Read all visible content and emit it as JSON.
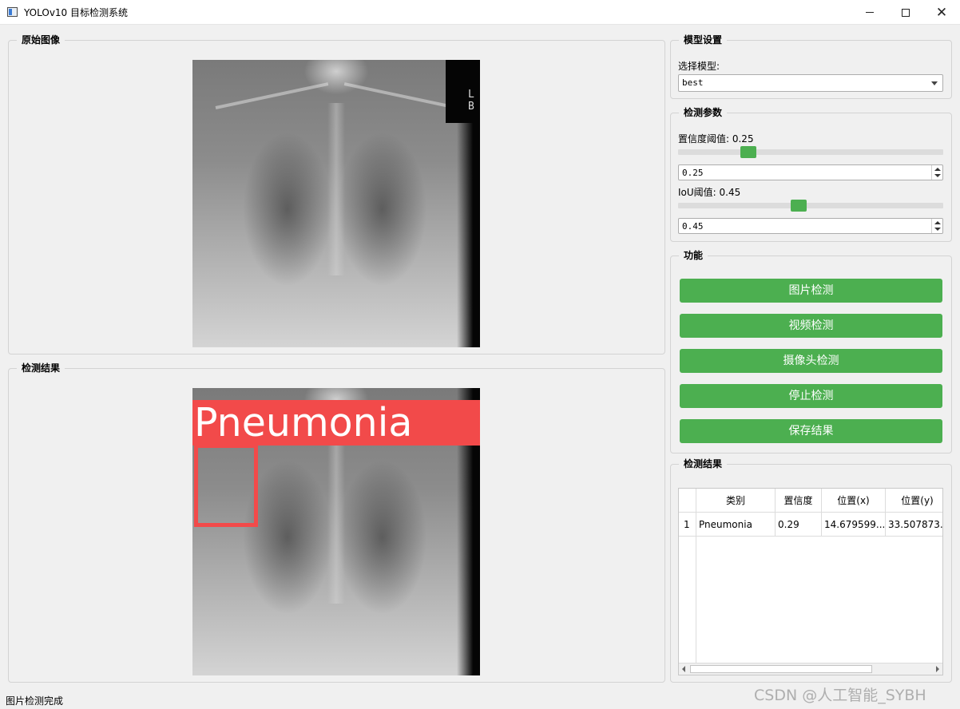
{
  "window": {
    "title": "YOLOv10 目标检测系统"
  },
  "panels": {
    "original_title": "原始图像",
    "result_title": "检测结果",
    "detection_label": "Pneumonia",
    "image_marker": "L\nB"
  },
  "model_settings": {
    "title": "模型设置",
    "select_label": "选择模型:",
    "selected_model": "best"
  },
  "params": {
    "title": "检测参数",
    "confidence_label": "置信度阈值: 0.25",
    "confidence_value": "0.25",
    "iou_label": "IoU阈值: 0.45",
    "iou_value": "0.45"
  },
  "functions": {
    "title": "功能",
    "buttons": [
      "图片检测",
      "视频检测",
      "摄像头检测",
      "停止检测",
      "保存结果"
    ]
  },
  "results": {
    "title": "检测结果",
    "columns": [
      "类别",
      "置信度",
      "位置(x)",
      "位置(y)"
    ],
    "rows": [
      {
        "index": "1",
        "class": "Pneumonia",
        "confidence": "0.29",
        "x": "14.679599...",
        "y": "33.507873..."
      }
    ]
  },
  "status_bar": "图片检测完成",
  "watermark": "CSDN @人工智能_SYBH",
  "colors": {
    "accent_green": "#4caf50",
    "detection_red": "#f24a4a"
  }
}
